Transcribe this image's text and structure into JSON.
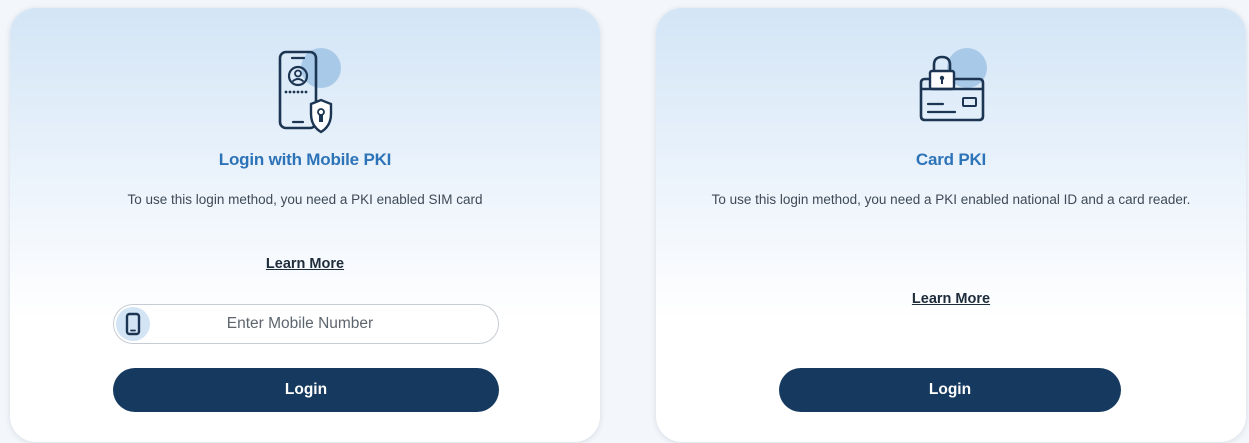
{
  "mobile_pki": {
    "icon": "mobile-pki-icon",
    "title": "Login with Mobile PKI",
    "description": "To use this login method, you need a PKI enabled SIM card",
    "learn_more": "Learn More",
    "mobile_input_placeholder": "Enter Mobile Number",
    "login_label": "Login"
  },
  "card_pki": {
    "icon": "card-pki-icon",
    "title": "Card PKI",
    "description": "To use this login method, you need a PKI enabled national ID and a card reader.",
    "learn_more": "Learn More",
    "login_label": "Login"
  },
  "colors": {
    "accent_title": "#2d73b8",
    "button_bg": "#163a5f",
    "icon_circle": "#a9c9e8"
  }
}
